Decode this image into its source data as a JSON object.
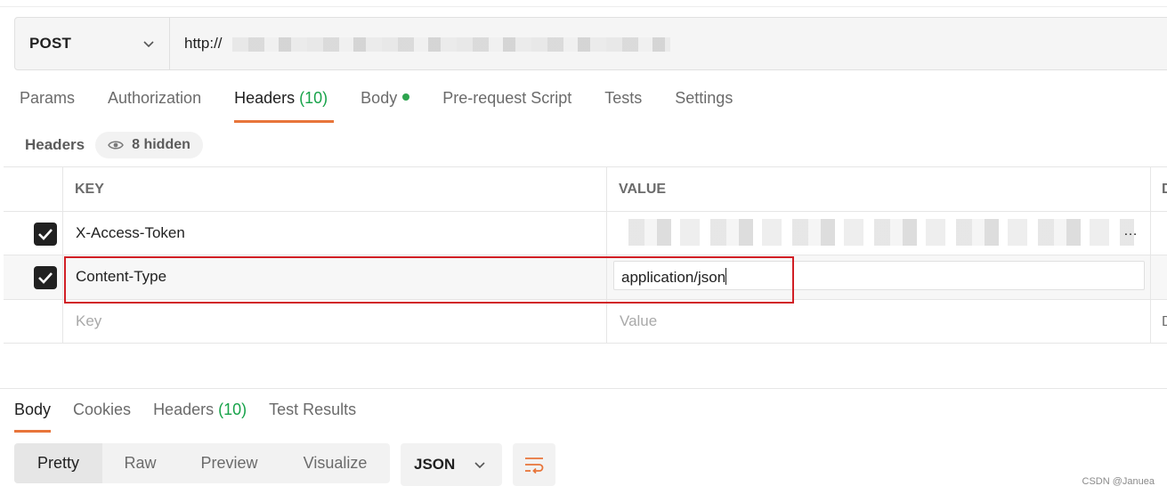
{
  "request": {
    "method": "POST",
    "url": "http://"
  },
  "request_tabs": [
    {
      "label": "Params"
    },
    {
      "label": "Authorization"
    },
    {
      "label": "Headers",
      "count": "(10)"
    },
    {
      "label": "Body"
    },
    {
      "label": "Pre-request Script"
    },
    {
      "label": "Tests"
    },
    {
      "label": "Settings"
    }
  ],
  "headers_section": {
    "title": "Headers",
    "hidden_label": "8 hidden"
  },
  "table": {
    "columns": {
      "key": "KEY",
      "value": "VALUE",
      "description": "D"
    },
    "rows": [
      {
        "key": "X-Access-Token",
        "value": "…",
        "checked": true
      },
      {
        "key": "Content-Type",
        "value": "application/json",
        "checked": true
      }
    ],
    "placeholder": {
      "key": "Key",
      "value": "Value",
      "description": "D"
    }
  },
  "response_tabs": [
    {
      "label": "Body"
    },
    {
      "label": "Cookies"
    },
    {
      "label": "Headers",
      "count": "(10)"
    },
    {
      "label": "Test Results"
    }
  ],
  "view_modes": [
    "Pretty",
    "Raw",
    "Preview",
    "Visualize"
  ],
  "format": "JSON",
  "colors": {
    "accent": "#e8753a",
    "count": "#18a34a",
    "highlight": "#d11f25"
  },
  "watermark": "CSDN @Januea"
}
